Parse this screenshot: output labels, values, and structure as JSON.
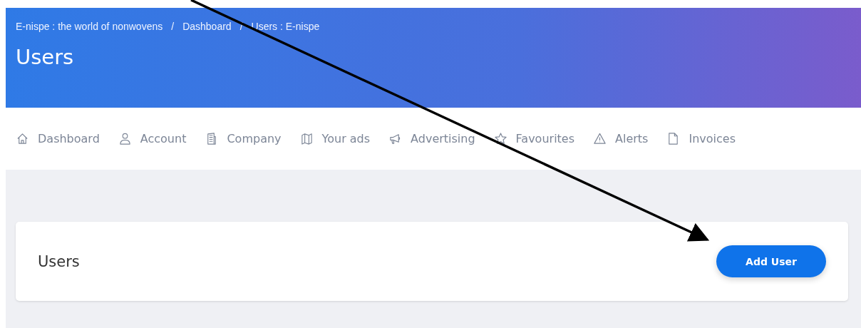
{
  "breadcrumb": [
    "E-nispe : the world of nonwovens",
    "Dashboard",
    "Users : E-nispe"
  ],
  "breadcrumb_separator": "/",
  "page_title": "Users",
  "nav": [
    {
      "label": "Dashboard",
      "kind": "home"
    },
    {
      "label": "Account",
      "kind": "user"
    },
    {
      "label": "Company",
      "kind": "building"
    },
    {
      "label": "Your ads",
      "kind": "map"
    },
    {
      "label": "Advertising",
      "kind": "megaphone"
    },
    {
      "label": "Favourites",
      "kind": "star"
    },
    {
      "label": "Alerts",
      "kind": "warning"
    },
    {
      "label": "Invoices",
      "kind": "file"
    }
  ],
  "card": {
    "title": "Users",
    "button": "Add User"
  }
}
